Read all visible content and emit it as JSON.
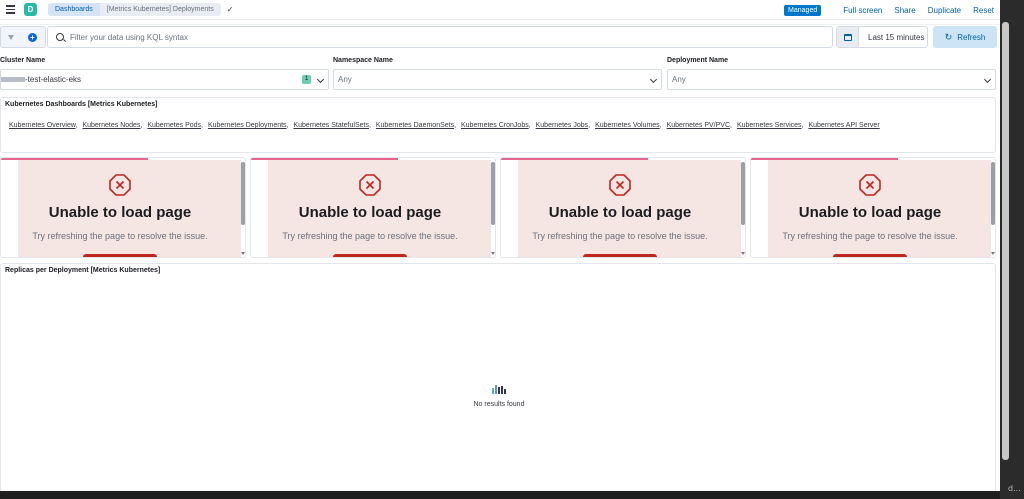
{
  "header": {
    "logo_letter": "D",
    "breadcrumbs": [
      "Dashboards",
      "[Metrics Kubernetes] Deployments"
    ],
    "managed_badge": "Managed",
    "actions": [
      "Full screen",
      "Share",
      "Duplicate",
      "Reset"
    ]
  },
  "query_bar": {
    "placeholder": "Filter your data using KQL syntax",
    "time_range": "Last 15 minutes",
    "refresh_label": "Refresh"
  },
  "controls": [
    {
      "label": "Cluster Name",
      "value": "-test-elastic-eks",
      "count": "1"
    },
    {
      "label": "Namespace Name",
      "value": "Any"
    },
    {
      "label": "Deployment Name",
      "value": "Any"
    }
  ],
  "links_panel": {
    "title": "Kubernetes Dashboards [Metrics Kubernetes]",
    "links": [
      "Kubernetes Overview",
      "Kubernetes Nodes",
      "Kubernetes Pods",
      "Kubernetes Deployments",
      "Kubernetes StatefulSets",
      "Kubernetes DaemonSets",
      "Kubernetes CronJobs",
      "Kubernetes Jobs",
      "Kubernetes Volumes",
      "Kubernetes PV/PVC",
      "Kubernetes Services",
      "Kubernetes API Server"
    ]
  },
  "error_panels": [
    {
      "title": "Unable to load page",
      "message": "Try refreshing the page to resolve the issue."
    },
    {
      "title": "Unable to load page",
      "message": "Try refreshing the page to resolve the issue."
    },
    {
      "title": "Unable to load page",
      "message": "Try refreshing the page to resolve the issue."
    },
    {
      "title": "Unable to load page",
      "message": "Try refreshing the page to resolve the issue."
    }
  ],
  "replicas_panel": {
    "title": "Replicas per Deployment [Metrics Kubernetes]",
    "empty_message": "No results found"
  },
  "side_text": "d...",
  "colors": {
    "accent": "#0077cc",
    "logo": "#28b9a6",
    "error_bg": "#f6e6e3",
    "error_accent": "#bd271e",
    "panel_topbar": "#e7648e"
  }
}
